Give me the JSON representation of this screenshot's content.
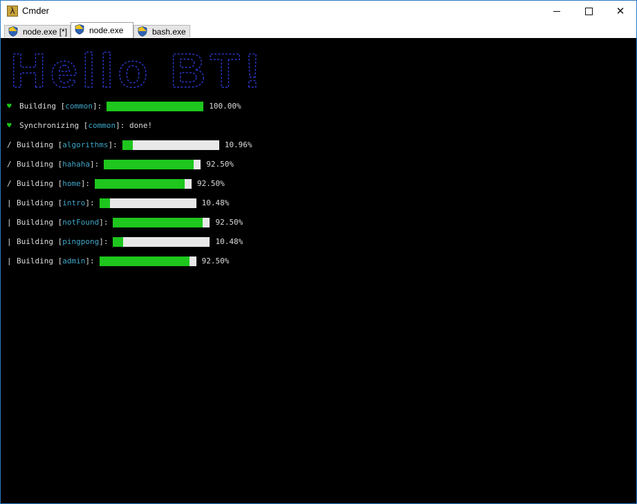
{
  "window": {
    "title": "Cmder",
    "app_icon_glyph": "λ",
    "minimize_icon": "minimize-icon",
    "maximize_icon": "maximize-icon",
    "close_icon": "close-icon",
    "close_glyph": "✕"
  },
  "tabs": [
    {
      "label": "node.exe [*]",
      "active": false,
      "icon": "shield-icon"
    },
    {
      "label": "node.exe",
      "active": true,
      "icon": "shield-icon"
    },
    {
      "label": "bash.exe",
      "active": false,
      "icon": "shield-icon"
    }
  ],
  "toolbar": {
    "add_icon": "add-console-icon",
    "add_glyph": "+",
    "view_icon": "view-icon",
    "lock_icon": "lock-icon",
    "panel_icon": "panel-view-icon",
    "menu_icon": "hamburger-menu-icon"
  },
  "console": {
    "banner_text": "Hello BT!",
    "banner_color": "#2c39c9",
    "lines": [
      {
        "prefix": "♥",
        "prefix_kind": "heart",
        "action": "Building",
        "name": "common",
        "progress": 1.0,
        "percent": "100.00%"
      },
      {
        "prefix": "♥",
        "prefix_kind": "heart",
        "action": "Synchronizing",
        "name": "common",
        "status": "done!"
      },
      {
        "prefix": "/",
        "prefix_kind": "spinner",
        "action": "Building",
        "name": "algorithms",
        "progress": 0.1096,
        "percent": "10.96%"
      },
      {
        "prefix": "/",
        "prefix_kind": "spinner",
        "action": "Building",
        "name": "hahaha",
        "progress": 0.925,
        "percent": "92.50%"
      },
      {
        "prefix": "/",
        "prefix_kind": "spinner",
        "action": "Building",
        "name": "home",
        "progress": 0.925,
        "percent": "92.50%"
      },
      {
        "prefix": "|",
        "prefix_kind": "spinner",
        "action": "Building",
        "name": "intro",
        "progress": 0.1048,
        "percent": "10.48%"
      },
      {
        "prefix": "|",
        "prefix_kind": "spinner",
        "action": "Building",
        "name": "notFound",
        "progress": 0.925,
        "percent": "92.50%"
      },
      {
        "prefix": "|",
        "prefix_kind": "spinner",
        "action": "Building",
        "name": "pingpong",
        "progress": 0.1048,
        "percent": "10.48%"
      },
      {
        "prefix": "|",
        "prefix_kind": "spinner",
        "action": "Building",
        "name": "admin",
        "progress": 0.925,
        "percent": "92.50%"
      }
    ],
    "colors": {
      "background": "#000000",
      "text": "#dcdcdc",
      "name": "#3fa6c8",
      "heart": "#18c718",
      "bar_fill": "#1ec61e",
      "bar_track": "#e8e8e8"
    }
  }
}
